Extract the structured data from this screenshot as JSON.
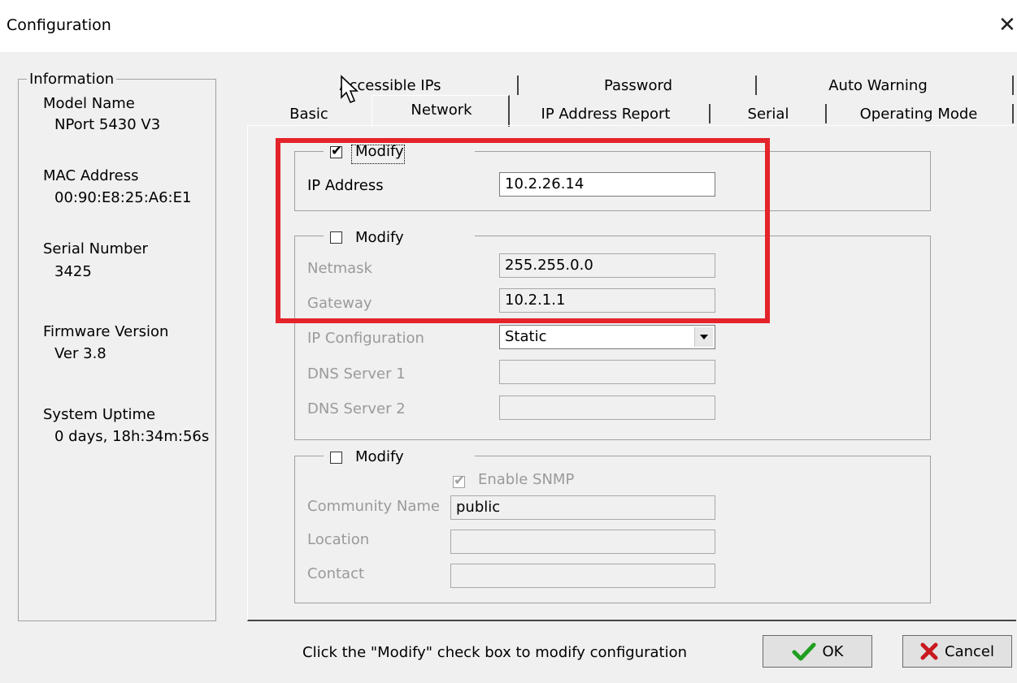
{
  "window": {
    "title": "Configuration",
    "close_glyph": "✕"
  },
  "info": {
    "legend": "Information",
    "model_name_label": "Model Name",
    "model_name": "NPort 5430 V3",
    "mac_label": "MAC Address",
    "mac": "00:90:E8:25:A6:E1",
    "serial_label": "Serial Number",
    "serial": "3425",
    "firmware_label": "Firmware Version",
    "firmware": "Ver 3.8",
    "uptime_label": "System Uptime",
    "uptime": "0 days, 18h:34m:56s"
  },
  "tabs": {
    "row1": [
      "Accessible IPs",
      "Password",
      "Auto Warning"
    ],
    "row2": [
      "Basic",
      "Network",
      "IP Address Report",
      "Serial",
      "Operating Mode"
    ],
    "active": "Network"
  },
  "ip_section": {
    "modify_label": "Modify",
    "modify_checked": true,
    "ip_label": "IP Address",
    "ip_value": "10.2.26.14"
  },
  "net_section": {
    "modify_label": "Modify",
    "modify_checked": false,
    "netmask_label": "Netmask",
    "netmask_value": "255.255.0.0",
    "gateway_label": "Gateway",
    "gateway_value": "10.2.1.1",
    "ipconfig_label": "IP Configuration",
    "ipconfig_value": "Static",
    "dns1_label": "DNS Server 1",
    "dns1_value": "",
    "dns2_label": "DNS Server 2",
    "dns2_value": ""
  },
  "snmp_section": {
    "modify_label": "Modify",
    "modify_checked": false,
    "enable_snmp_label": "Enable SNMP",
    "enable_snmp_checked": true,
    "community_label": "Community Name",
    "community_value": "public",
    "location_label": "Location",
    "location_value": "",
    "contact_label": "Contact",
    "contact_value": ""
  },
  "footer": {
    "hint": "Click the \"Modify\" check box to modify configuration",
    "ok_label": "OK",
    "cancel_label": "Cancel"
  },
  "colors": {
    "highlight": "#e4232b",
    "ok_check": "#1f9e1f",
    "cancel_x": "#c8191e"
  },
  "icons": {
    "ok": "check-icon",
    "cancel": "x-icon",
    "close": "close-icon",
    "dropdown": "dropdown-arrow-icon",
    "cursor": "mouse-cursor-icon"
  }
}
